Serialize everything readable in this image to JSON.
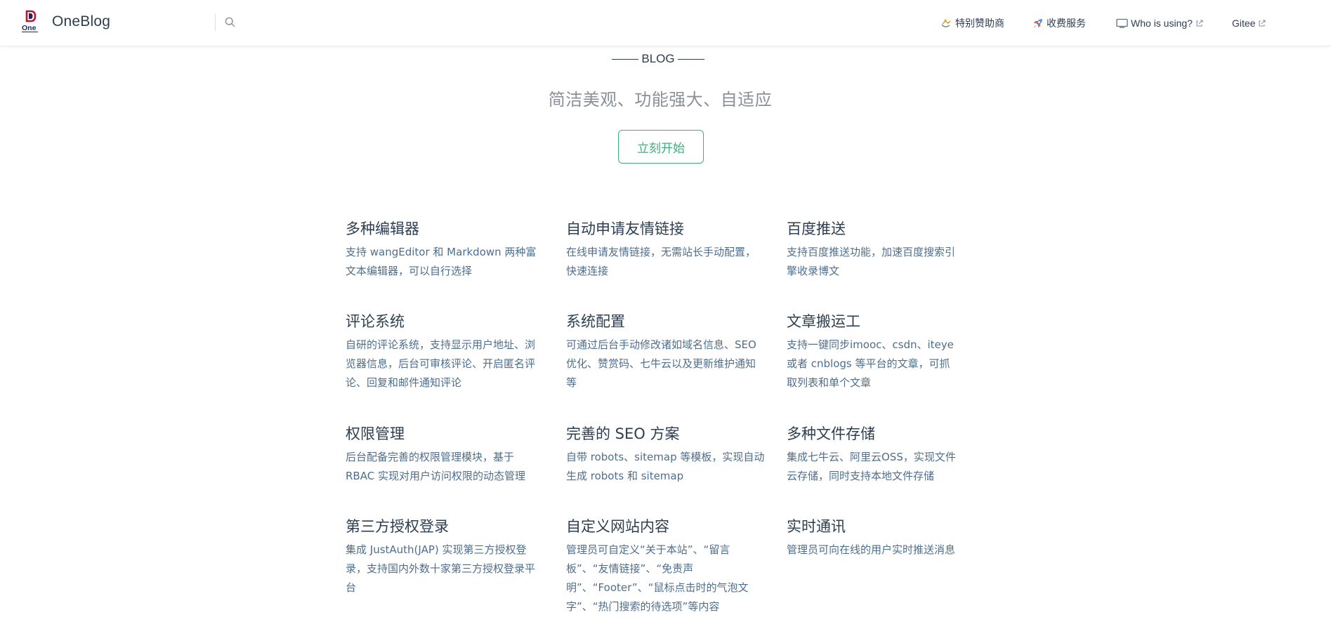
{
  "navbar": {
    "brand": "OneBlog",
    "logo_text": "One",
    "links": [
      {
        "label": "特别赞助商",
        "icon": "sponsor-icon",
        "external": false
      },
      {
        "label": "收费服务",
        "icon": "rocket-icon",
        "external": false
      },
      {
        "label": "Who is using?",
        "icon": "monitor-icon",
        "external": true
      },
      {
        "label": "Gitee",
        "icon": "",
        "external": true
      }
    ]
  },
  "hero": {
    "tag": "BLOG",
    "description": "简洁美观、功能强大、自适应",
    "action_label": "立刻开始"
  },
  "features": [
    {
      "title": "多种编辑器",
      "details": "支持 wangEditor 和 Markdown 两种富文本编辑器，可以自行选择"
    },
    {
      "title": "自动申请友情链接",
      "details": "在线申请友情链接，无需站长手动配置，快速连接"
    },
    {
      "title": "百度推送",
      "details": "支持百度推送功能，加速百度搜索引擎收录博文"
    },
    {
      "title": "评论系统",
      "details": "自研的评论系统，支持显示用户地址、浏览器信息，后台可审核评论、开启匿名评论、回复和邮件通知评论"
    },
    {
      "title": "系统配置",
      "details": "可通过后台手动修改诸如域名信息、SEO优化、赞赏码、七牛云以及更新维护通知等"
    },
    {
      "title": "文章搬运工",
      "details": "支持一键同步imooc、csdn、iteye 或者 cnblogs 等平台的文章，可抓取列表和单个文章"
    },
    {
      "title": "权限管理",
      "details": "后台配备完善的权限管理模块，基于 RBAC 实现对用户访问权限的动态管理"
    },
    {
      "title": "完善的 SEO 方案",
      "details": "自带 robots、sitemap 等模板，实现自动生成 robots 和 sitemap"
    },
    {
      "title": "多种文件存储",
      "details": "集成七牛云、阿里云OSS，实现文件云存储，同时支持本地文件存储"
    },
    {
      "title": "第三方授权登录",
      "details": "集成 JustAuth(JAP) 实现第三方授权登录，支持国内外数十家第三方授权登录平台"
    },
    {
      "title": "自定义网站内容",
      "details": "管理员可自定义“关于本站”、“留言板”、“友情链接”、“免责声明”、“Footer”、“鼠标点击时的气泡文字”、“热门搜索的待选项”等内容"
    },
    {
      "title": "实时通讯",
      "details": "管理员可向在线的用户实时推送消息"
    }
  ],
  "colors": {
    "accent": "#3eaf7c",
    "text": "#2c3e50",
    "muted": "#4e6e8e"
  }
}
